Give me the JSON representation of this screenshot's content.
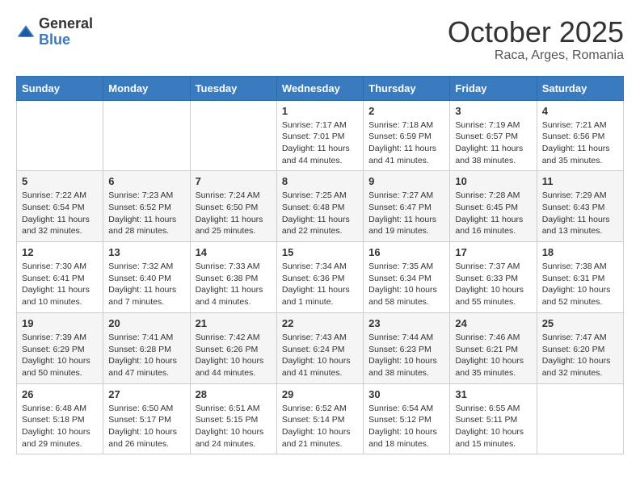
{
  "header": {
    "logo_general": "General",
    "logo_blue": "Blue",
    "month": "October 2025",
    "location": "Raca, Arges, Romania"
  },
  "weekdays": [
    "Sunday",
    "Monday",
    "Tuesday",
    "Wednesday",
    "Thursday",
    "Friday",
    "Saturday"
  ],
  "weeks": [
    [
      {
        "day": "",
        "info": ""
      },
      {
        "day": "",
        "info": ""
      },
      {
        "day": "",
        "info": ""
      },
      {
        "day": "1",
        "info": "Sunrise: 7:17 AM\nSunset: 7:01 PM\nDaylight: 11 hours and 44 minutes."
      },
      {
        "day": "2",
        "info": "Sunrise: 7:18 AM\nSunset: 6:59 PM\nDaylight: 11 hours and 41 minutes."
      },
      {
        "day": "3",
        "info": "Sunrise: 7:19 AM\nSunset: 6:57 PM\nDaylight: 11 hours and 38 minutes."
      },
      {
        "day": "4",
        "info": "Sunrise: 7:21 AM\nSunset: 6:56 PM\nDaylight: 11 hours and 35 minutes."
      }
    ],
    [
      {
        "day": "5",
        "info": "Sunrise: 7:22 AM\nSunset: 6:54 PM\nDaylight: 11 hours and 32 minutes."
      },
      {
        "day": "6",
        "info": "Sunrise: 7:23 AM\nSunset: 6:52 PM\nDaylight: 11 hours and 28 minutes."
      },
      {
        "day": "7",
        "info": "Sunrise: 7:24 AM\nSunset: 6:50 PM\nDaylight: 11 hours and 25 minutes."
      },
      {
        "day": "8",
        "info": "Sunrise: 7:25 AM\nSunset: 6:48 PM\nDaylight: 11 hours and 22 minutes."
      },
      {
        "day": "9",
        "info": "Sunrise: 7:27 AM\nSunset: 6:47 PM\nDaylight: 11 hours and 19 minutes."
      },
      {
        "day": "10",
        "info": "Sunrise: 7:28 AM\nSunset: 6:45 PM\nDaylight: 11 hours and 16 minutes."
      },
      {
        "day": "11",
        "info": "Sunrise: 7:29 AM\nSunset: 6:43 PM\nDaylight: 11 hours and 13 minutes."
      }
    ],
    [
      {
        "day": "12",
        "info": "Sunrise: 7:30 AM\nSunset: 6:41 PM\nDaylight: 11 hours and 10 minutes."
      },
      {
        "day": "13",
        "info": "Sunrise: 7:32 AM\nSunset: 6:40 PM\nDaylight: 11 hours and 7 minutes."
      },
      {
        "day": "14",
        "info": "Sunrise: 7:33 AM\nSunset: 6:38 PM\nDaylight: 11 hours and 4 minutes."
      },
      {
        "day": "15",
        "info": "Sunrise: 7:34 AM\nSunset: 6:36 PM\nDaylight: 11 hours and 1 minute."
      },
      {
        "day": "16",
        "info": "Sunrise: 7:35 AM\nSunset: 6:34 PM\nDaylight: 10 hours and 58 minutes."
      },
      {
        "day": "17",
        "info": "Sunrise: 7:37 AM\nSunset: 6:33 PM\nDaylight: 10 hours and 55 minutes."
      },
      {
        "day": "18",
        "info": "Sunrise: 7:38 AM\nSunset: 6:31 PM\nDaylight: 10 hours and 52 minutes."
      }
    ],
    [
      {
        "day": "19",
        "info": "Sunrise: 7:39 AM\nSunset: 6:29 PM\nDaylight: 10 hours and 50 minutes."
      },
      {
        "day": "20",
        "info": "Sunrise: 7:41 AM\nSunset: 6:28 PM\nDaylight: 10 hours and 47 minutes."
      },
      {
        "day": "21",
        "info": "Sunrise: 7:42 AM\nSunset: 6:26 PM\nDaylight: 10 hours and 44 minutes."
      },
      {
        "day": "22",
        "info": "Sunrise: 7:43 AM\nSunset: 6:24 PM\nDaylight: 10 hours and 41 minutes."
      },
      {
        "day": "23",
        "info": "Sunrise: 7:44 AM\nSunset: 6:23 PM\nDaylight: 10 hours and 38 minutes."
      },
      {
        "day": "24",
        "info": "Sunrise: 7:46 AM\nSunset: 6:21 PM\nDaylight: 10 hours and 35 minutes."
      },
      {
        "day": "25",
        "info": "Sunrise: 7:47 AM\nSunset: 6:20 PM\nDaylight: 10 hours and 32 minutes."
      }
    ],
    [
      {
        "day": "26",
        "info": "Sunrise: 6:48 AM\nSunset: 5:18 PM\nDaylight: 10 hours and 29 minutes."
      },
      {
        "day": "27",
        "info": "Sunrise: 6:50 AM\nSunset: 5:17 PM\nDaylight: 10 hours and 26 minutes."
      },
      {
        "day": "28",
        "info": "Sunrise: 6:51 AM\nSunset: 5:15 PM\nDaylight: 10 hours and 24 minutes."
      },
      {
        "day": "29",
        "info": "Sunrise: 6:52 AM\nSunset: 5:14 PM\nDaylight: 10 hours and 21 minutes."
      },
      {
        "day": "30",
        "info": "Sunrise: 6:54 AM\nSunset: 5:12 PM\nDaylight: 10 hours and 18 minutes."
      },
      {
        "day": "31",
        "info": "Sunrise: 6:55 AM\nSunset: 5:11 PM\nDaylight: 10 hours and 15 minutes."
      },
      {
        "day": "",
        "info": ""
      }
    ]
  ]
}
